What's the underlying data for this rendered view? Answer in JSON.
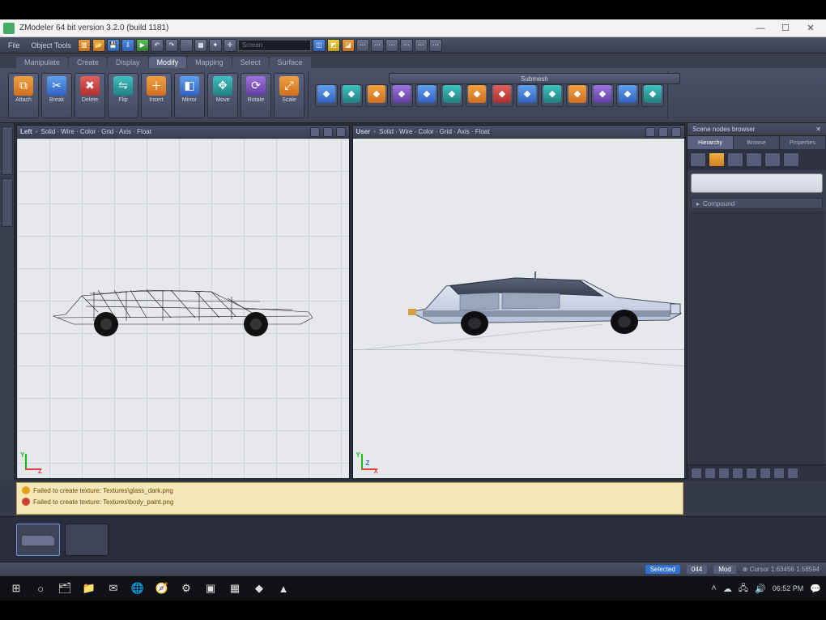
{
  "window": {
    "title": "ZModeler 64 bit version 3.2.0 (build 1181)",
    "min": "—",
    "max": "☐",
    "close": "✕"
  },
  "menu": {
    "file": "File",
    "edit": "Object Tools"
  },
  "search": {
    "placeholder": "Screen"
  },
  "ribbon_tabs": [
    "Manipulate",
    "Create",
    "Display",
    "Modify",
    "Mapping",
    "Select",
    "Surface"
  ],
  "ribbon_active_index": 3,
  "ribbon_buttons": [
    {
      "label": "Attach",
      "color": "orange",
      "glyph": "⧉"
    },
    {
      "label": "Break",
      "color": "blue",
      "glyph": "✂"
    },
    {
      "label": "Delete",
      "color": "red",
      "glyph": "✖"
    },
    {
      "label": "Flip",
      "color": "teal",
      "glyph": "⇋"
    },
    {
      "label": "Insert",
      "color": "orange",
      "glyph": "＋"
    },
    {
      "label": "Mirror",
      "color": "blue",
      "glyph": "◧"
    },
    {
      "label": "Move",
      "color": "teal",
      "glyph": "✥"
    },
    {
      "label": "Rotate",
      "color": "purple",
      "glyph": "⟳"
    },
    {
      "label": "Scale",
      "color": "orange",
      "glyph": "⤢"
    }
  ],
  "ribbon_extra_icons": 14,
  "ribbon_section_label": "Submesh",
  "viewports": {
    "left": {
      "name": "Left",
      "toolbar": "Solid · Wire · Color · Grid · Axis · Float"
    },
    "right": {
      "name": "User",
      "toolbar": "Solid · Wire · Color · Grid · Axis · Float"
    },
    "axis_y": "Y",
    "axis_x": "X",
    "axis_z": "Z"
  },
  "side_panel": {
    "title": "Scene nodes browser",
    "tabs": [
      "Hierarchy",
      "Browse",
      "Properties"
    ],
    "active_tab": 0,
    "big_button": " ",
    "section1": "Compound",
    "close": "✕"
  },
  "log": {
    "line1": "Failed to create texture: Textures\\glass_dark.png",
    "line2": "Failed to create texture: Textures\\body_paint.png"
  },
  "status": {
    "selected_label": "Selected",
    "selected_value": "044",
    "mode": "Mod",
    "cursor": "⊕ Cursor  1.63456  1.58594"
  },
  "taskbar": {
    "items": [
      "⊞",
      "○",
      "🗂",
      "📁",
      "✉",
      "🌐",
      "🧭",
      "⚙",
      "▣",
      "▦",
      "◆",
      "▲"
    ],
    "tray_up": "˄",
    "tray_cloud": "☁",
    "tray_net": "🖧",
    "tray_vol": "🔊",
    "time": "06:52 PM",
    "notif": "💬"
  },
  "colors": {
    "panel": "#3a3f50",
    "accent": "#f0a040",
    "viewport_bg": "#e6e8ec"
  }
}
